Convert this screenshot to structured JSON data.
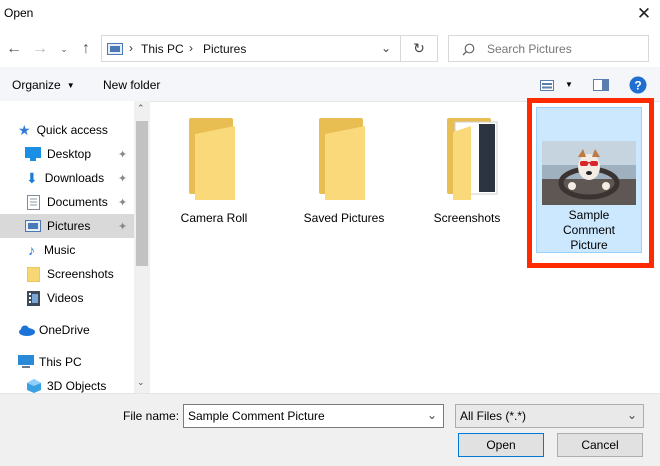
{
  "window": {
    "title": "Open"
  },
  "address": {
    "crumbs": [
      "This PC",
      "Pictures"
    ],
    "search_placeholder": "Search Pictures"
  },
  "toolbar": {
    "organize": "Organize",
    "new_folder": "New folder"
  },
  "sidebar": {
    "quick_access": "Quick access",
    "items": [
      {
        "label": "Desktop",
        "icon": "desktop-icon",
        "pinned": true
      },
      {
        "label": "Downloads",
        "icon": "download-icon",
        "pinned": true
      },
      {
        "label": "Documents",
        "icon": "documents-icon",
        "pinned": true
      },
      {
        "label": "Pictures",
        "icon": "pictures-icon",
        "pinned": true,
        "selected": true
      },
      {
        "label": "Music",
        "icon": "music-icon"
      },
      {
        "label": "Screenshots",
        "icon": "folder-icon"
      },
      {
        "label": "Videos",
        "icon": "video-icon"
      }
    ],
    "onedrive": "OneDrive",
    "this_pc": "This PC",
    "objects_3d": "3D Objects"
  },
  "files": [
    {
      "label": "Camera Roll"
    },
    {
      "label": "Saved Pictures"
    },
    {
      "label": "Screenshots"
    },
    {
      "label": "Sample Comment Picture",
      "line1": "Sample",
      "line2": "Comment",
      "line3": "Picture",
      "selected": true
    }
  ],
  "bottom": {
    "file_name_label": "File name:",
    "file_name_value": "Sample Comment Picture",
    "filter": "All Files (*.*)",
    "open": "Open",
    "cancel": "Cancel"
  },
  "colors": {
    "highlight_border": "#ff2a00",
    "selection": "#cce8ff",
    "accent": "#0078d7"
  }
}
